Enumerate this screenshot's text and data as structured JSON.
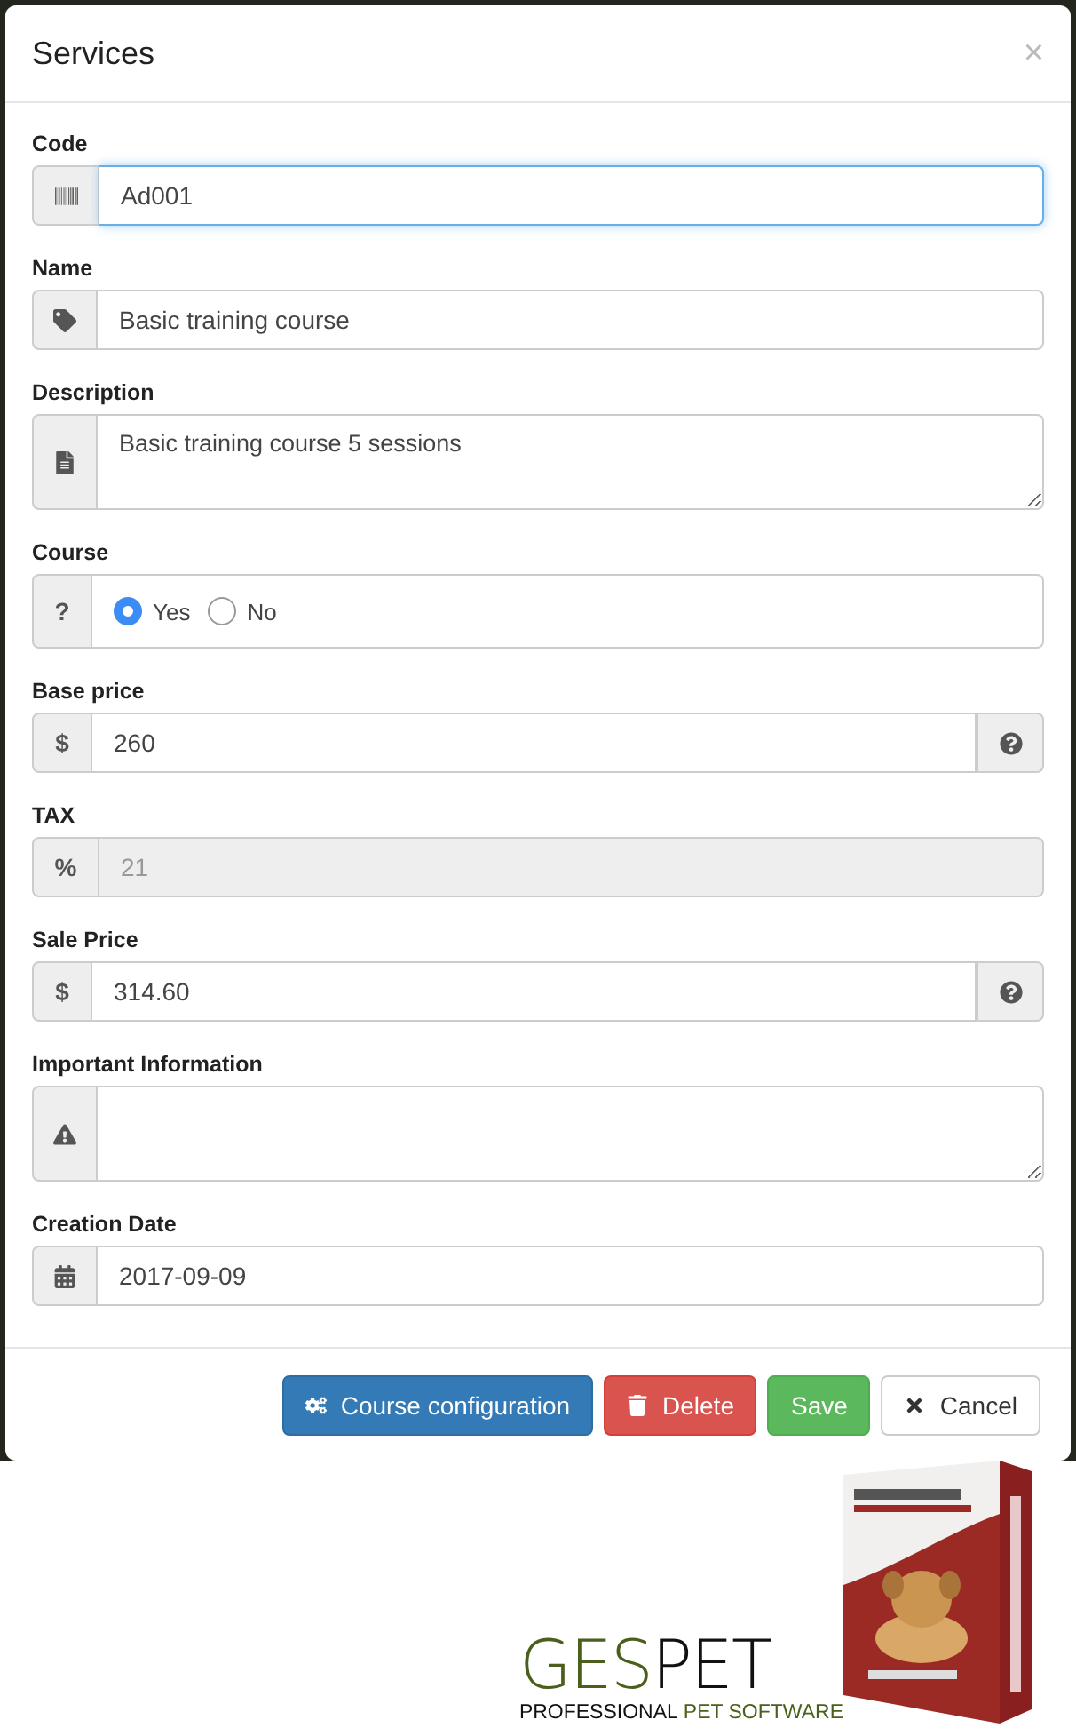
{
  "dialog": {
    "title": "Services",
    "close": "×"
  },
  "fields": [
    {
      "kind": "input",
      "label": "Code",
      "value": "Ad001",
      "focused": true,
      "disabled": false,
      "help": false
    },
    {
      "kind": "input",
      "label": "Name",
      "value": "Basic training course",
      "focused": false,
      "disabled": false,
      "help": false
    },
    {
      "kind": "textarea",
      "label": "Description",
      "value": "Basic training course 5 sessions"
    },
    {
      "kind": "radio",
      "label": "Course",
      "addon": "?",
      "options": [
        {
          "label": "Yes",
          "selected": true
        },
        {
          "label": "No",
          "selected": false
        }
      ]
    },
    {
      "kind": "input",
      "label": "Base price",
      "addon": "$",
      "value": "260",
      "focused": false,
      "disabled": false,
      "help": true
    },
    {
      "kind": "input",
      "label": "TAX",
      "addon": "%",
      "value": "21",
      "focused": false,
      "disabled": true,
      "help": false
    },
    {
      "kind": "input",
      "label": "Sale Price",
      "addon": "$",
      "value": "314.60",
      "focused": false,
      "disabled": false,
      "help": true
    },
    {
      "kind": "textarea",
      "label": "Important Information"
    },
    {
      "kind": "input",
      "label": "Creation Date",
      "value": "2017-09-09",
      "focused": false,
      "disabled": false,
      "help": false
    }
  ],
  "buttons": [
    {
      "kind": "primary",
      "label": "Course configuration"
    },
    {
      "kind": "danger",
      "label": "Delete"
    },
    {
      "kind": "success",
      "label": "Save"
    },
    {
      "kind": "default",
      "label": "Cancel"
    }
  ],
  "logo": {
    "parts": [
      {
        "text": "GES",
        "color": "#4b5f1c"
      },
      {
        "text": "PET",
        "color": "#111111"
      }
    ],
    "tagline": [
      {
        "text": "PROFESSIONAL",
        "color": "#111111"
      },
      {
        "text": "PET SOFTWARE",
        "color": "#4b5f1c"
      }
    ]
  }
}
